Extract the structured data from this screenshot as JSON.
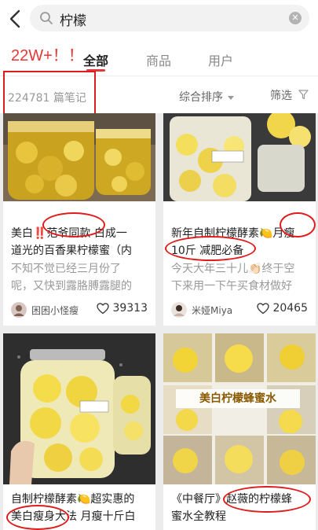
{
  "search": {
    "query": "柠檬"
  },
  "annotation": {
    "count_label": "22W+！！"
  },
  "tabs": [
    {
      "label": "全部",
      "active": true
    },
    {
      "label": "商品",
      "active": false
    },
    {
      "label": "用户",
      "active": false
    }
  ],
  "results": {
    "count_label": "224781 篇笔记"
  },
  "toolbar": {
    "sort_label": "综合排序",
    "filter_label": "筛选"
  },
  "cards": [
    {
      "title_line1": "美白‼️范爷同款 白成一",
      "title_line2": "道光的百香果柠檬蜜（内",
      "desc_line1": "不知不觉已经三月份了",
      "desc_line2": "呢，又快到露胳膊露腿的",
      "author": "困困小怪瘦",
      "likes": "39313"
    },
    {
      "title_line1": "新年自制柠檬酵素🍋月瘦",
      "title_line2": "10斤 减肥必备",
      "desc_line1": "今天大年三十儿👏🏻终于空",
      "desc_line2": "下来用一下午买食材做好",
      "author": "米娅Miya",
      "likes": "20465"
    },
    {
      "title_line1": "自制柠檬酵素🍋超实惠的",
      "title_line2": "美白瘦身大法 月瘦十斤白"
    },
    {
      "banner": "美白柠檬蜂蜜水",
      "title_line1": "《中餐厅》赵薇的柠檬蜂",
      "title_line2": "蜜水全教程"
    }
  ],
  "colors": {
    "accent": "#e5383a",
    "annotation_red": "#e01b1b",
    "background": "#ececec"
  }
}
